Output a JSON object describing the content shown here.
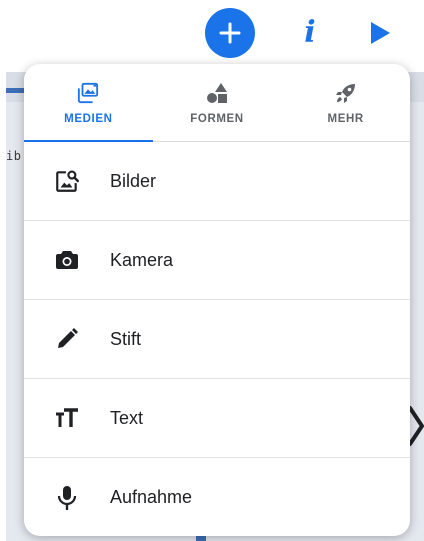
{
  "background": {
    "snippet_text": "ib"
  },
  "toolbar": {
    "add_icon": "plus-icon",
    "info_icon": "info-icon",
    "info_glyph": "i",
    "play_icon": "play-icon"
  },
  "tabs": [
    {
      "label": "MEDIEN",
      "icon": "media-icon",
      "active": true
    },
    {
      "label": "FORMEN",
      "icon": "shapes-icon",
      "active": false
    },
    {
      "label": "MEHR",
      "icon": "rocket-icon",
      "active": false
    }
  ],
  "menu_items": [
    {
      "label": "Bilder",
      "icon": "image-search-icon"
    },
    {
      "label": "Kamera",
      "icon": "camera-icon"
    },
    {
      "label": "Stift",
      "icon": "pencil-icon"
    },
    {
      "label": "Text",
      "icon": "text-size-icon"
    },
    {
      "label": "Aufnahme",
      "icon": "microphone-icon"
    }
  ],
  "colors": {
    "accent": "#1a73e8",
    "tab_inactive": "#5f6368",
    "icon_dark": "#202124",
    "background_canvas": "#e4e8ef"
  }
}
